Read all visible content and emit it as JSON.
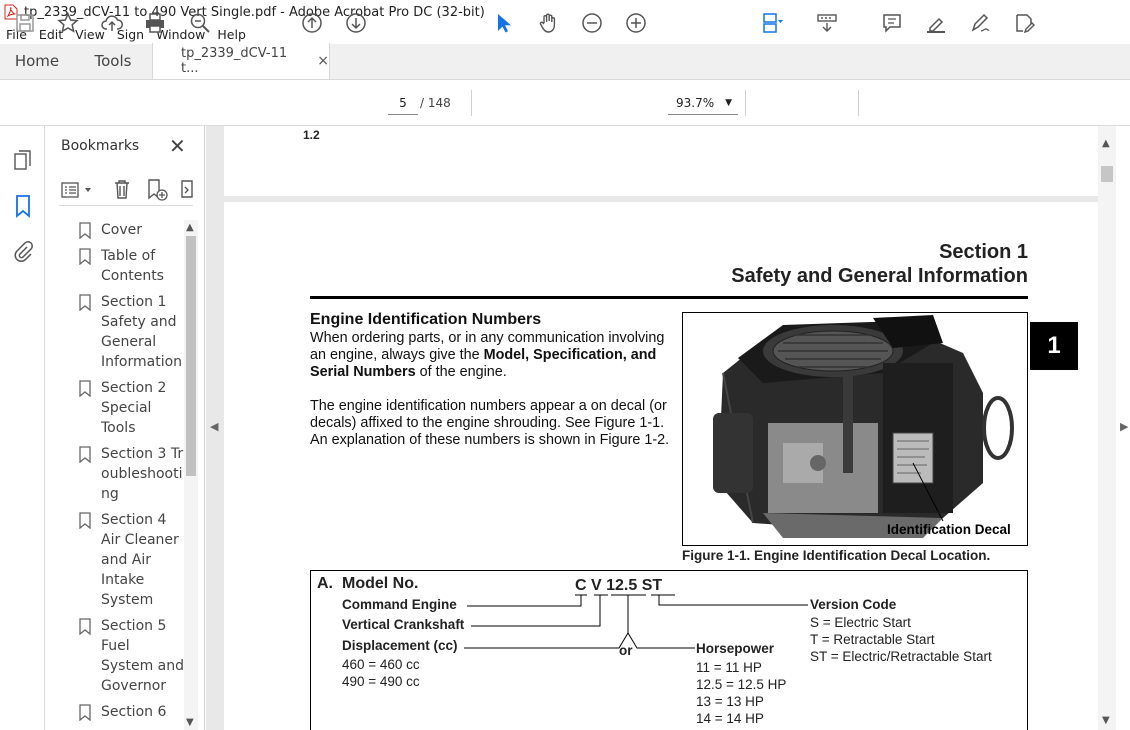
{
  "window": {
    "title": "tp_2339_dCV-11 to 490 Vert Single.pdf - Adobe Acrobat Pro DC (32-bit)"
  },
  "menu": [
    "File",
    "Edit",
    "View",
    "Sign",
    "Window",
    "Help"
  ],
  "tabs": {
    "home": "Home",
    "tools": "Tools",
    "doc": "tp_2339_dCV-11 t...",
    "close": "×"
  },
  "toolbar": {
    "page_current": "5",
    "page_total": "/ 148",
    "zoom": "93.7%"
  },
  "bookmarks": {
    "title": "Bookmarks",
    "items": [
      "Cover",
      "Table of Contents",
      "Section 1 Safety and General Information",
      "Section 2 Special Tools",
      "Section 3 Troubleshooting",
      "Section 4 Air Cleaner and Air Intake System",
      "Section 5 Fuel System and Governor",
      "Section 6"
    ]
  },
  "doc": {
    "prev_page_label": "1.2",
    "section_line1": "Section 1",
    "section_line2": "Safety and General Information",
    "section_tab": "1",
    "heading": "Engine Identification Numbers",
    "para1_a": "When ordering parts, or in any communication involving an engine, always give the ",
    "para1_b": "Model, Specification, and Serial Numbers",
    "para1_c": " of the engine.",
    "para2": "The engine identification numbers appear a on decal (or decals) affixed to the engine shrouding. See Figure 1-1. An explanation of these numbers is shown in Figure 1-2.",
    "fig_label": "Identification Decal",
    "fig_caption": "Figure 1-1. Engine Identification Decal Location.",
    "model": {
      "section_letter": "A.",
      "title": "Model No.",
      "code": "C V 12.5 ST",
      "command_engine": "Command Engine",
      "vertical_crankshaft": "Vertical Crankshaft",
      "displacement": "Displacement (cc)",
      "disp_values": [
        "460 = 460 cc",
        "490 = 490 cc"
      ],
      "or": "or",
      "horsepower": "Horsepower",
      "hp_values": [
        "11 = 11 HP",
        "12.5 = 12.5 HP",
        "13 = 13 HP",
        "14 = 14 HP"
      ],
      "version_code": "Version Code",
      "version_values": [
        "S = Electric Start",
        "T = Retractable Start",
        "ST = Electric/Retractable Start"
      ]
    }
  }
}
